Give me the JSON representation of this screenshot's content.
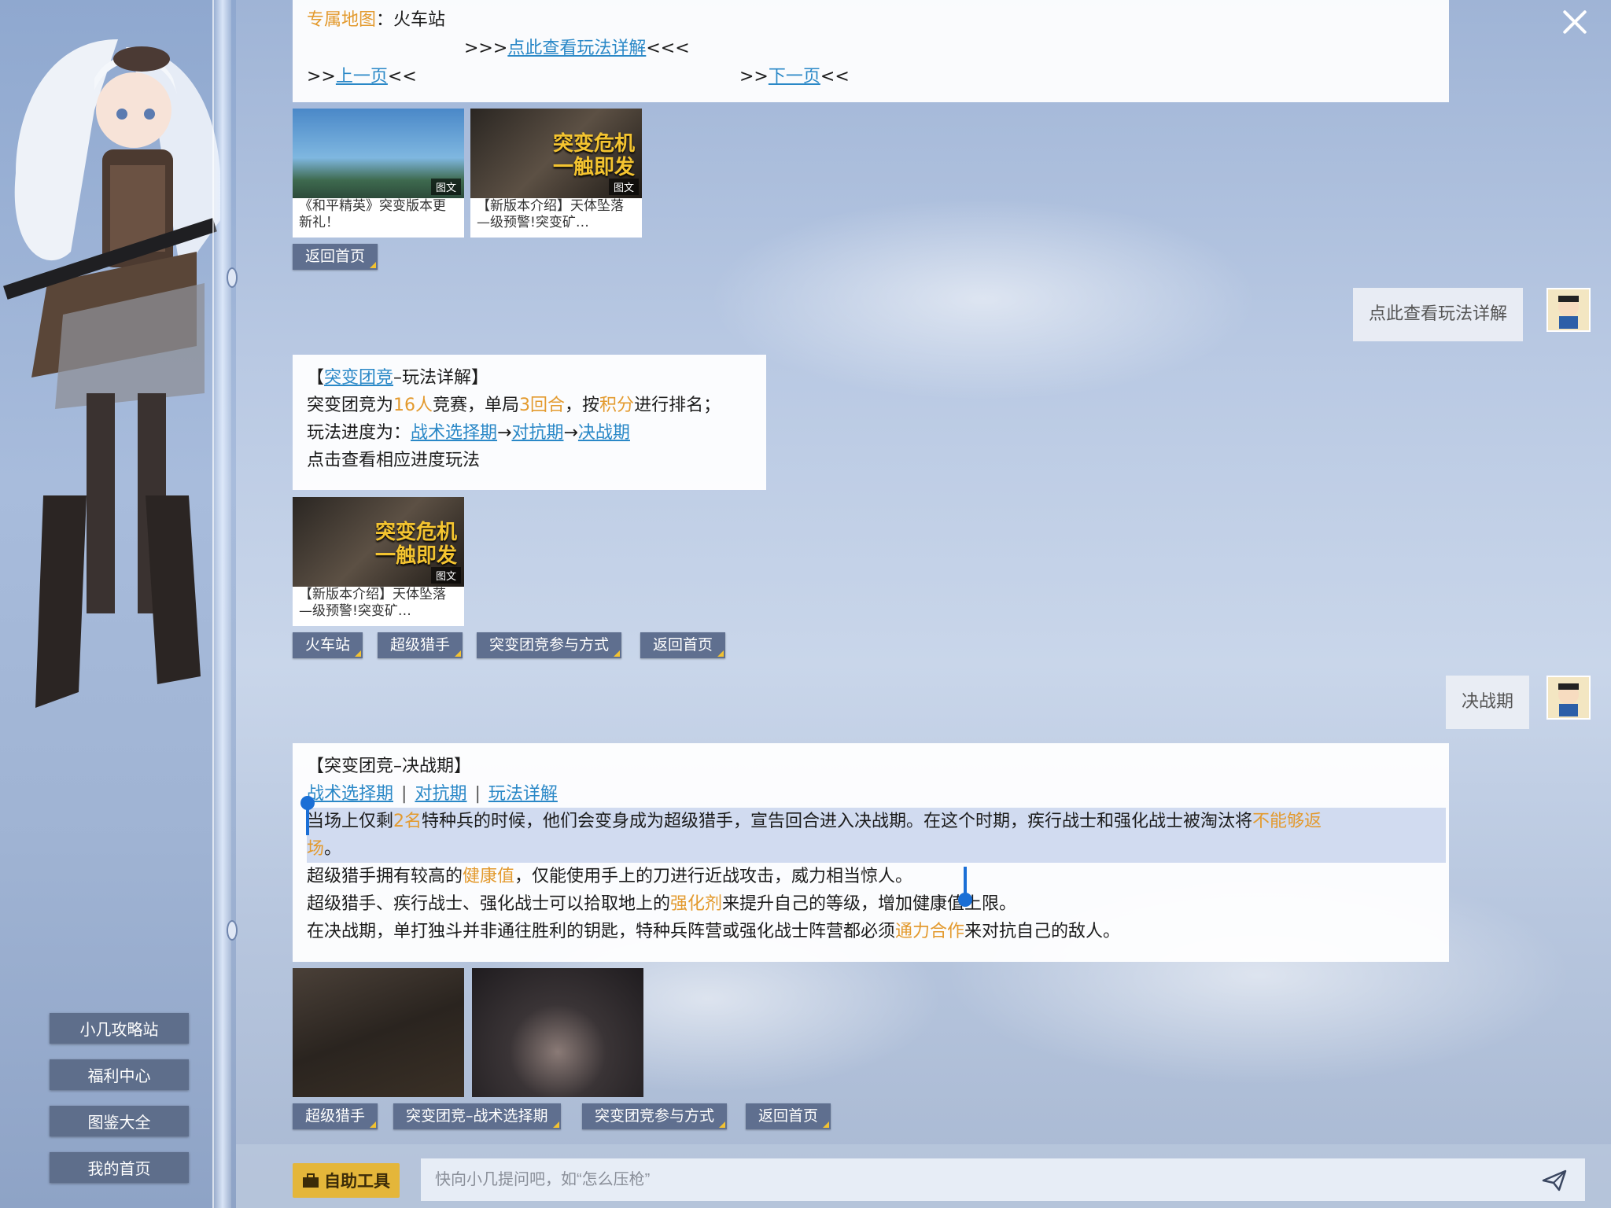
{
  "window": {
    "close_label": "close"
  },
  "sidebar": {
    "items": [
      {
        "label": "小几攻略站"
      },
      {
        "label": "福利中心"
      },
      {
        "label": "图鉴大全"
      },
      {
        "label": "我的首页"
      }
    ]
  },
  "msg1": {
    "map_label": "专属地图",
    "map_colon": "：",
    "map_value": "火车站",
    "detail_prefix": ">>>",
    "detail_link": "点此查看玩法详解",
    "detail_suffix": "<<<",
    "prev_prefix": ">>",
    "prev_link": "上一页",
    "prev_suffix": "<<",
    "next_prefix": ">>",
    "next_link": "下一页",
    "next_suffix": "<<"
  },
  "cards1": [
    {
      "caption": "《和平精英》突变版本更新礼！",
      "tag": "图文"
    },
    {
      "caption": "【新版本介绍】天体坠落—级预警!突变矿…",
      "tag": "图文",
      "overlay": "突变危机 一触即发"
    }
  ],
  "buttons1": [
    {
      "label": "返回首页"
    }
  ],
  "user_msg1": {
    "text": "点此查看玩法详解"
  },
  "msg2": {
    "title_open": "【",
    "title_link": "突变团竞",
    "title_rest": "–玩法详解】",
    "line2_a": "突变团竞为",
    "line2_b": "16人",
    "line2_c": "竞赛，单局",
    "line2_d": "3回合",
    "line2_e": "，按",
    "line2_f": "积分",
    "line2_g": "进行排名；",
    "line3_a": "玩法进度为：",
    "line3_link1": "战术选择期",
    "arrow": "→",
    "line3_link2": "对抗期",
    "line3_link3": "决战期",
    "line4": "点击查看相应进度玩法"
  },
  "cards2": [
    {
      "caption": "【新版本介绍】天体坠落—级预警!突变矿…",
      "tag": "图文",
      "overlay": "突变危机 一触即发"
    }
  ],
  "buttons2": [
    {
      "label": "火车站"
    },
    {
      "label": "超级猎手"
    },
    {
      "label": "突变团竞参与方式"
    },
    {
      "label": "返回首页"
    }
  ],
  "user_msg2": {
    "text": "决战期"
  },
  "msg3": {
    "title": "【突变团竞–决战期】",
    "link1": "战术选择期",
    "link2": "对抗期",
    "link3": "玩法详解",
    "sep": "|",
    "p1_a": "当场上仅剩",
    "p1_b": "2名",
    "p1_c": "特种兵的时候，他们会变身成为超级猎手，宣告回合进入决战期。在这个时期，疾行战士和强化战士被淘汰将",
    "p1_d": "不能够返",
    "p1_e": "场",
    "p1_f": "。",
    "p2_a": "超级猎手拥有较高的",
    "p2_b": "健康值",
    "p2_c": "，仅能使用手上的刀进行近战攻击，威力相当惊人。",
    "p3_a": "超级猎手、疾行战士、强化战士可以拾取地上的",
    "p3_b": "强化剂",
    "p3_c": "来提升自己的等级，增加健康值上限。",
    "p4_a": "在决战期，单打独斗并非通往胜利的钥匙，特种兵阵营或强化战士阵营都必须",
    "p4_b": "通力合作",
    "p4_c": "来对抗自己的敌人。"
  },
  "buttons3": [
    {
      "label": "超级猎手"
    },
    {
      "label": "突变团竞–战术选择期"
    },
    {
      "label": "突变团竞参与方式"
    },
    {
      "label": "返回首页"
    }
  ],
  "bottom": {
    "tool_label": "自助工具",
    "input_placeholder": "快向小几提问吧，如“怎么压枪”"
  },
  "colors": {
    "accent_orange": "#e39a2e",
    "link_blue": "#2a88c7",
    "button_bg": "#5f6f8f",
    "tool_yellow": "#e4b63a"
  }
}
